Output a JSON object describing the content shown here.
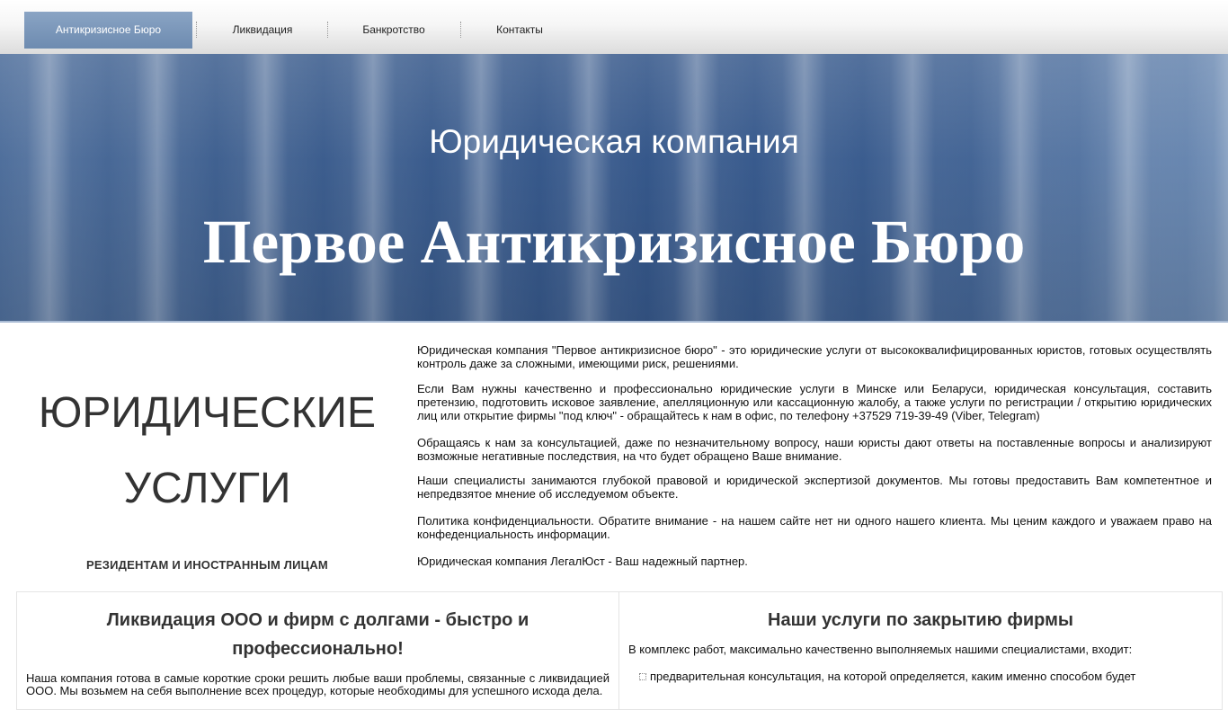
{
  "nav": {
    "items": [
      {
        "label": "Антикризисное Бюро"
      },
      {
        "label": "Ликвидация"
      },
      {
        "label": "Банкротство"
      },
      {
        "label": "Контакты"
      }
    ]
  },
  "hero": {
    "subtitle": "Юридическая компания",
    "title": "Первое Антикризисное Бюро"
  },
  "services": {
    "heading_line1": "ЮРИДИЧЕСКИЕ",
    "heading_line2": "УСЛУГИ",
    "subheading": "РЕЗИДЕНТАМ И ИНОСТРАННЫМ ЛИЦАМ"
  },
  "intro": {
    "p1": "Юридическая компания \"Первое антикризисное бюро\" - это юридические услуги от высококвалифицированных юристов, готовых осуществлять контроль даже за сложными, имеющими риск, решениями.",
    "p2": "Если Вам нужны качественно и профессионально юридические услуги в Минске или Беларуси, юридическая консультация, составить претензию, подготовить исковое заявление, апелляционную или кассационную жалобу, а также услуги по регистрации / открытию юридических лиц или открытие фирмы \"под ключ\" - обращайтесь к нам в офис, по телефону +37529 719-39-49 (Viber, Telegram)",
    "p3": "Обращаясь к нам за консультацией, даже по незначительному вопросу, наши юристы дают ответы на поставленные вопросы и анализируют возможные негативные последствия, на что будет обращено Ваше внимание.",
    "p4": "Наши специалисты занимаются глубокой правовой и юридической экспертизой документов. Мы готовы предоставить Вам компетентное и непредвзятое мнение об исследуемом объекте.",
    "p5": "Политика конфиденциальности. Обратите внимание - на нашем сайте нет ни одного нашего клиента. Мы ценим каждого и уважаем право на конфеденциальность информации.",
    "p6": "Юридическая компания ЛегалЮст - Ваш надежный партнер."
  },
  "panel_left": {
    "title": "Ликвидация ООО и фирм с долгами - быстро и профессионально!",
    "text": "Наша компания готова в самые короткие сроки решить любые ваши проблемы, связанные с ликвидацией ООО. Мы возьмем на себя выполнение всех процедур, которые необходимы для успешного исхода дела."
  },
  "panel_right": {
    "title": "Наши услуги по закрытию фирмы",
    "intro": "В комплекс работ, максимально качественно выполняемых нашими специалистами, входит:",
    "bullet1": "предварительная консультация, на которой определяется, каким именно способом будет"
  }
}
